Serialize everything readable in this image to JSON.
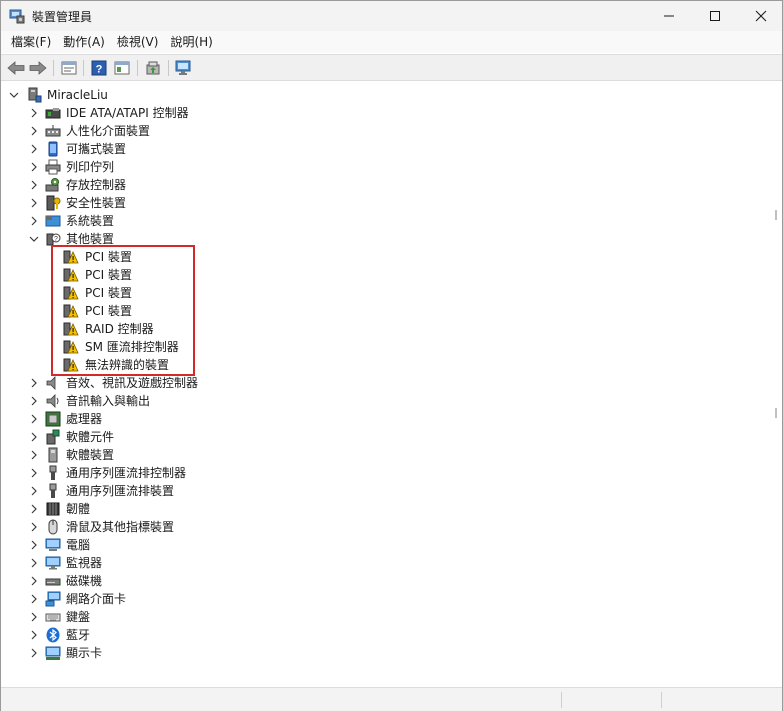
{
  "window": {
    "title": "裝置管理員"
  },
  "menu": [
    {
      "label": "檔案(F)",
      "name": "menu-file"
    },
    {
      "label": "動作(A)",
      "name": "menu-action"
    },
    {
      "label": "檢視(V)",
      "name": "menu-view"
    },
    {
      "label": "說明(H)",
      "name": "menu-help"
    }
  ],
  "toolbar": {
    "buttons": [
      "back-icon",
      "forward-icon",
      "properties-icon",
      "help-icon",
      "console-tree-icon",
      "update-driver-icon",
      "scan-hardware-icon"
    ]
  },
  "tree": {
    "root": "MiracleLiu",
    "categories": [
      {
        "label": "IDE ATA/ATAPI 控制器",
        "icon": "ide-controller-icon"
      },
      {
        "label": "人性化介面裝置",
        "icon": "hid-icon"
      },
      {
        "label": "可攜式裝置",
        "icon": "portable-device-icon"
      },
      {
        "label": "列印佇列",
        "icon": "printer-icon"
      },
      {
        "label": "存放控制器",
        "icon": "storage-controller-icon"
      },
      {
        "label": "安全性裝置",
        "icon": "security-device-icon"
      },
      {
        "label": "系統裝置",
        "icon": "system-device-icon"
      },
      {
        "label": "其他裝置",
        "icon": "other-devices-icon",
        "expanded": true
      }
    ],
    "other_devices": [
      {
        "label": "PCI 裝置"
      },
      {
        "label": "PCI 裝置"
      },
      {
        "label": "PCI 裝置"
      },
      {
        "label": "PCI 裝置"
      },
      {
        "label": "RAID 控制器"
      },
      {
        "label": "SM 匯流排控制器"
      },
      {
        "label": "無法辨識的裝置"
      }
    ],
    "categories_after": [
      {
        "label": "音效、視訊及遊戲控制器",
        "icon": "sound-icon"
      },
      {
        "label": "音訊輸入與輸出",
        "icon": "audio-io-icon"
      },
      {
        "label": "處理器",
        "icon": "processor-icon"
      },
      {
        "label": "軟體元件",
        "icon": "software-component-icon"
      },
      {
        "label": "軟體裝置",
        "icon": "software-device-icon"
      },
      {
        "label": "通用序列匯流排控制器",
        "icon": "usb-controller-icon"
      },
      {
        "label": "通用序列匯流排裝置",
        "icon": "usb-device-icon"
      },
      {
        "label": "韌體",
        "icon": "firmware-icon"
      },
      {
        "label": "滑鼠及其他指標裝置",
        "icon": "mouse-icon"
      },
      {
        "label": "電腦",
        "icon": "computer-icon"
      },
      {
        "label": "監視器",
        "icon": "monitor-icon"
      },
      {
        "label": "磁碟機",
        "icon": "disk-drive-icon"
      },
      {
        "label": "網路介面卡",
        "icon": "network-adapter-icon"
      },
      {
        "label": "鍵盤",
        "icon": "keyboard-icon"
      },
      {
        "label": "藍牙",
        "icon": "bluetooth-icon"
      },
      {
        "label": "顯示卡",
        "icon": "display-adapter-icon"
      }
    ]
  },
  "colors": {
    "highlight": "#d12a2a",
    "warning": "#f2c200",
    "bluetooth": "#1a6fd6"
  }
}
